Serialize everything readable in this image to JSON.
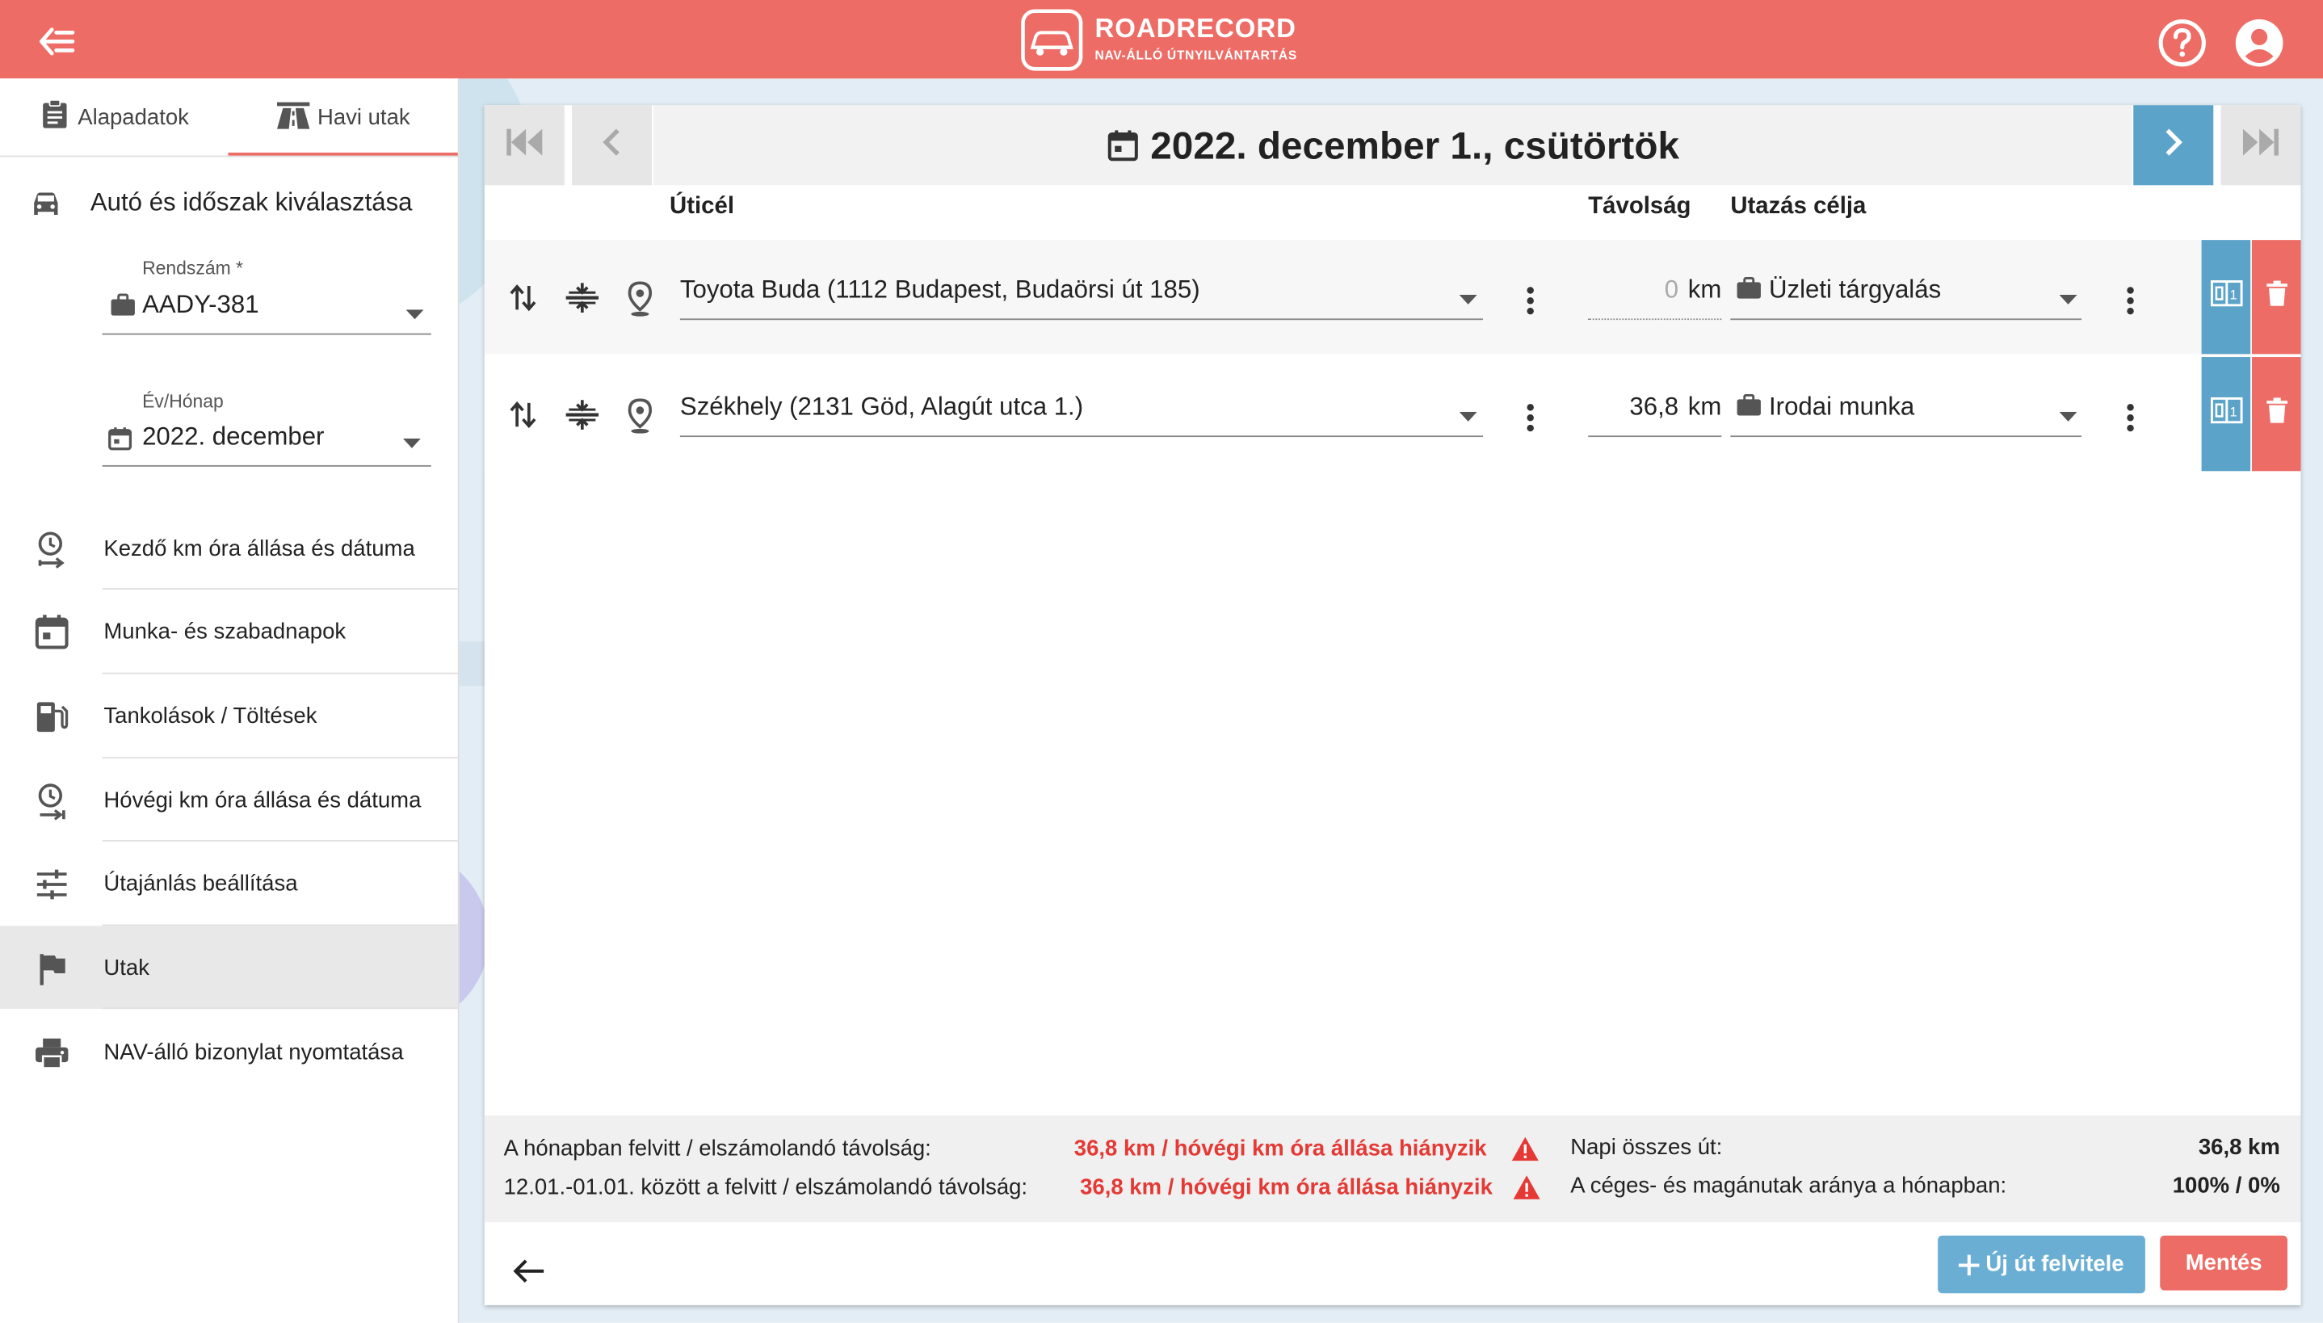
{
  "header": {
    "brand": "ROADRECORD",
    "brand_sub": "NAV-ÁLLÓ ÚTNYILVÁNTARTÁS",
    "colors": {
      "primary": "#ed6d66",
      "accent_blue": "#5ba3c9"
    }
  },
  "sidebar": {
    "tabs": [
      {
        "label": "Alapadatok",
        "icon": "clipboard-icon"
      },
      {
        "label": "Havi utak",
        "icon": "road-icon",
        "active": true
      }
    ],
    "car_section_title": "Autó és időszak kiválasztása",
    "plate": {
      "label": "Rendszám *",
      "value": "AADY-381"
    },
    "month": {
      "label": "Év/Hónap",
      "value": "2022. december"
    },
    "items": [
      {
        "label": "Kezdő km óra állása és dátuma",
        "icon": "clock-start-icon"
      },
      {
        "label": "Munka- és szabadnapok",
        "icon": "calendar-icon"
      },
      {
        "label": "Tankolások / Töltések",
        "icon": "fuel-pump-icon"
      },
      {
        "label": "Hóvégi km óra állása és dátuma",
        "icon": "clock-end-icon"
      },
      {
        "label": "Útajánlás beállítása",
        "icon": "tune-icon"
      },
      {
        "label": "Utak",
        "icon": "flag-icon",
        "active": true
      },
      {
        "label": "NAV-álló bizonylat nyomtatása",
        "icon": "printer-icon"
      }
    ]
  },
  "main": {
    "date_title": "2022. december 1., csütörtök",
    "columns": {
      "destination": "Úticél",
      "distance": "Távolság",
      "purpose": "Utazás célja"
    },
    "trips": [
      {
        "destination": "Toyota Buda (1112 Budapest, Budaörsi út 185)",
        "distance": "0",
        "unit": "km",
        "purpose": "Üzleti tárgyalás"
      },
      {
        "destination": "Székhely (2131 Göd, Alagút utca 1.)",
        "distance": "36,8",
        "unit": "km",
        "purpose": "Irodai munka"
      }
    ],
    "summary": {
      "monthly_label": "A hónapban felvitt / elszámolandó távolság:",
      "monthly_value": "36,8 km / hóvégi km óra állása hiányzik",
      "period_label": "12.01.-01.01. között a felvitt / elszámolandó távolság:",
      "period_value": "36,8 km / hóvégi km óra állása hiányzik",
      "daily_label": "Napi összes út:",
      "daily_value": "36,8 km",
      "ratio_label": "A céges- és magánutak aránya a hónapban:",
      "ratio_value": "100% / 0%"
    },
    "buttons": {
      "new_trip": "Új út felvitele",
      "save": "Mentés"
    }
  }
}
